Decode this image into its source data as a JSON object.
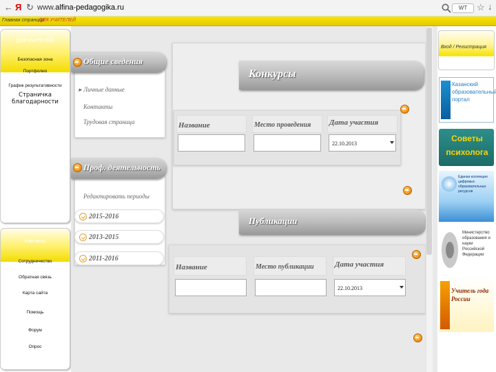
{
  "browser": {
    "back": "←",
    "yandex": "Я",
    "reload": "↻",
    "url_scheme": "www.",
    "url_host": "alfina-pedagogika.ru",
    "badge": "WT",
    "star": "☆",
    "download": "↓"
  },
  "site_strip": {
    "home_link": "Главная страница",
    "teachers_link": "ДЛЯ УЧИТЕЛЕЙ"
  },
  "left_panel_top": {
    "title": "ДЛЯ УЧИТЕЛЕЙ",
    "items": [
      "Безопасная зона",
      "Портфолио",
      "График результативности",
      "Страничка благодарности"
    ]
  },
  "left_panel_bottom": {
    "title": "Контакты",
    "items": [
      "Сотрудничество",
      "Обратная связь",
      "Карта сайта",
      "Помощь",
      "Форум",
      "Опрос"
    ]
  },
  "general": {
    "title": "Общие сведения",
    "items": [
      "Личные данные",
      "Контакты",
      "Трудовая страница"
    ]
  },
  "prof": {
    "title": "Проф. деятельность",
    "subtitle": "Редактировать периоды",
    "years": [
      "2015-2016",
      "2013-2015",
      "2011-2016"
    ]
  },
  "contests": {
    "title": "Конкурсы",
    "col_name": "Название",
    "col_place": "Место проведения",
    "col_date": "Дата участия",
    "date_value": "22.10.2013"
  },
  "publications": {
    "title": "Публикации",
    "col_name": "Название",
    "col_place": "Место публикации",
    "col_date": "Дата участия",
    "date_value": "22.10.2013"
  },
  "right_sidebar": {
    "login_label": "Вход / Регистрация",
    "banner1": "Казанский образовательный портал",
    "banner2": "Советы психолога",
    "banner3": "Единая коллекция цифровых образовательных ресурсов",
    "banner4": "Министерство образования и науки Российской Федерации",
    "banner5": "Учитель года России"
  },
  "colors": {
    "accent_yellow": "#f2dc00",
    "header_gray": "#9a9a9a",
    "orange": "#f09a1e"
  }
}
